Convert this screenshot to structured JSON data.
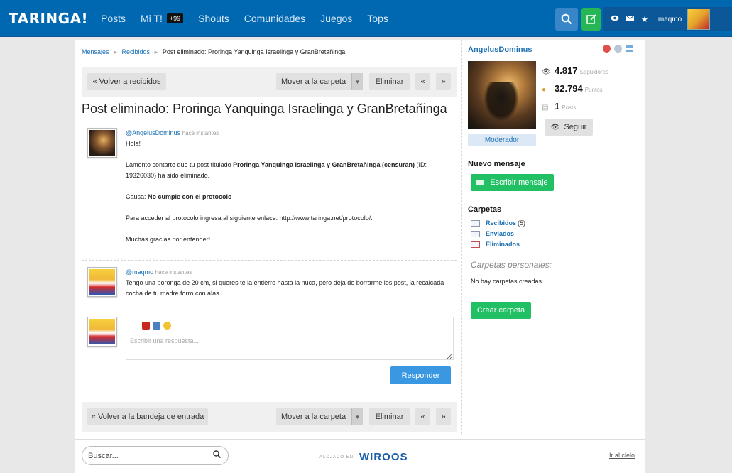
{
  "header": {
    "logo": "TARINGA!",
    "nav": [
      "Posts",
      "Mi T!",
      "Shouts",
      "Comunidades",
      "Juegos",
      "Tops"
    ],
    "mit_badge": "+99",
    "username": "maqmo"
  },
  "breadcrumb": {
    "items": [
      "Mensajes",
      "Recibidos"
    ],
    "current": "Post eliminado: Proringa Yanquinga Israelinga y GranBretañinga"
  },
  "toolbar_top": {
    "back": "« Volver a recibidos",
    "move": "Mover a la carpeta",
    "delete": "Eliminar",
    "prev": "«",
    "next": "»"
  },
  "toolbar_bottom": {
    "back": "« Volver a la bandeja de entrada",
    "move": "Mover a la carpeta",
    "delete": "Eliminar",
    "prev": "«",
    "next": "»"
  },
  "title": "Post eliminado: Proringa Yanquinga Israelinga y GranBretañinga",
  "messages": [
    {
      "author": "@AngelusDominus",
      "when": "hace instantes",
      "greeting": "Hola!",
      "p1_a": "Lamento contarte que tu post titulado ",
      "p1_b": "Proringa Yanquinga Israelinga y GranBretañinga (censuran)",
      "p1_c": " (ID: 19326030) ha sido eliminado.",
      "cause_label": "Causa: ",
      "cause": "No cumple con el protocolo",
      "p3": "Para acceder al protocolo ingresa al siguiente enlace: http://www.taringa.net/protocolo/.",
      "p4": "Muchas gracias por entender!"
    },
    {
      "author": "@maqmo",
      "when": "hace instantes",
      "text": "Tengo una poronga de 20 cm, si queres te la entierro hasta la nuca, pero deja de borrarme los post, la recalcada cocha de tu madre forro con alas"
    }
  ],
  "reply": {
    "placeholder": "Escribir una respuesta...",
    "button": "Responder"
  },
  "profile": {
    "name": "AngelusDominus",
    "role": "Moderador",
    "followers": "4.817",
    "followers_label": "Seguidores",
    "points": "32.794",
    "points_label": "Puntos",
    "posts": "1",
    "posts_label": "Posts",
    "follow_button": "Seguir"
  },
  "new_message": {
    "title": "Nuevo mensaje",
    "button": "Escribir mensaje"
  },
  "folders": {
    "title": "Carpetas",
    "items": [
      {
        "label": "Recibidos",
        "count": "(5)"
      },
      {
        "label": "Enviados",
        "count": ""
      },
      {
        "label": "Eliminados",
        "count": ""
      }
    ],
    "personal_title": "Carpetas personales:",
    "empty": "No hay carpetas creadas.",
    "create_button": "Crear carpeta"
  },
  "footer": {
    "search_placeholder": "Buscar...",
    "hosted_label": "ALOJADO EN",
    "hosted_brand": "WIROOS",
    "top_link": "Ir al cielo"
  },
  "colors": {
    "topbar": "#0067b1",
    "link": "#1a6fb3",
    "green": "#21c064",
    "blue_button": "#3a97e2"
  }
}
